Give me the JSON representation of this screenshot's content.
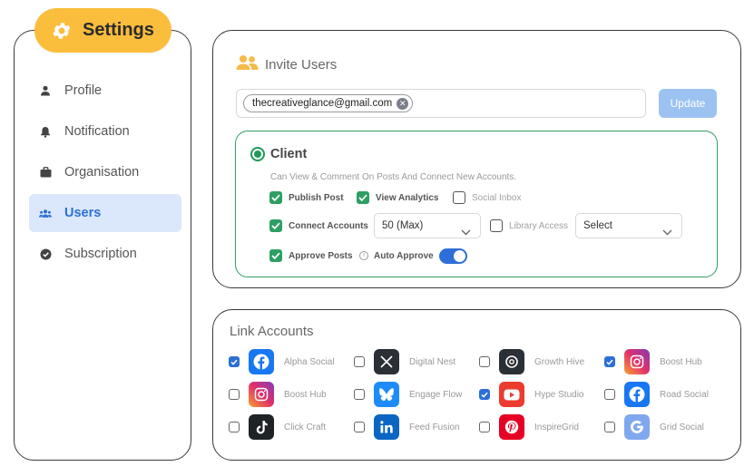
{
  "sidebar": {
    "title": "Settings",
    "items": [
      {
        "label": "Profile",
        "icon": "person-icon"
      },
      {
        "label": "Notification",
        "icon": "bell-icon"
      },
      {
        "label": "Organisation",
        "icon": "briefcase-icon"
      },
      {
        "label": "Users",
        "icon": "users-icon",
        "active": true
      },
      {
        "label": "Subscription",
        "icon": "check-circle-icon"
      }
    ]
  },
  "invite": {
    "title": "Invite Users",
    "email_chip": "thecreativeglance@gmail.com",
    "update_label": "Update"
  },
  "client": {
    "title": "Client",
    "description": "Can View & Comment On Posts And Connect New Accounts.",
    "permissions": {
      "publish_post": {
        "label": "Publish Post",
        "checked": true
      },
      "view_analytics": {
        "label": "View Analytics",
        "checked": true
      },
      "social_inbox": {
        "label": "Social Inbox",
        "checked": false
      },
      "connect_accounts": {
        "label": "Connect Accounts",
        "checked": true,
        "value": "50 (Max)"
      },
      "library_access": {
        "label": "Library Access",
        "checked": false,
        "value": "Select"
      },
      "approve_posts": {
        "label": "Approve Posts",
        "checked": true
      },
      "auto_approve": {
        "label": "Auto Approve",
        "on": true
      }
    }
  },
  "link_accounts": {
    "title": "Link Accounts",
    "accounts": [
      {
        "name": "Alpha Social",
        "platform": "facebook",
        "checked": true
      },
      {
        "name": "Digital Nest",
        "platform": "x",
        "checked": false
      },
      {
        "name": "Growth Hive",
        "platform": "threads",
        "checked": false
      },
      {
        "name": "Boost Hub",
        "platform": "instagram",
        "checked": true
      },
      {
        "name": "Boost Hub",
        "platform": "instagram",
        "checked": false
      },
      {
        "name": "Engage Flow",
        "platform": "bluesky",
        "checked": false
      },
      {
        "name": "Hype Studio",
        "platform": "youtube",
        "checked": true
      },
      {
        "name": "Road Social",
        "platform": "facebook",
        "checked": false
      },
      {
        "name": "Click Craft",
        "platform": "tiktok",
        "checked": false
      },
      {
        "name": "Feed Fusion",
        "platform": "linkedin",
        "checked": false
      },
      {
        "name": "InspireGrid",
        "platform": "pinterest",
        "checked": false
      },
      {
        "name": "Grid Social",
        "platform": "google",
        "checked": false
      }
    ]
  },
  "colors": {
    "accent_yellow": "#fbbd3c",
    "primary_blue": "#2d6fd6",
    "success_green": "#2e9f63",
    "active_bg": "#dbe8fb"
  }
}
